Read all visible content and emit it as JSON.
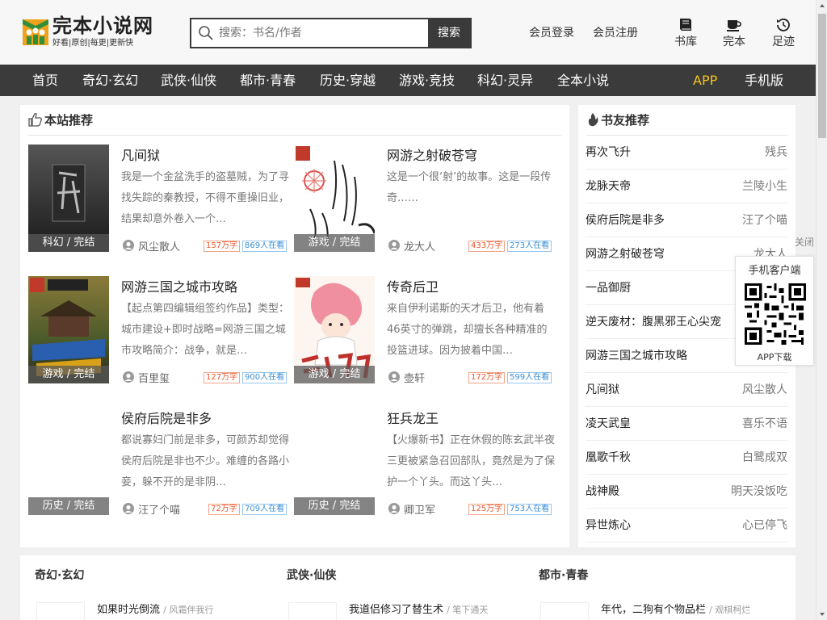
{
  "header": {
    "logo": {
      "title": "完本小说网",
      "subtitle": "好看|原创|每更|更新快"
    },
    "search": {
      "placeholder": "搜索：书名/作者",
      "button": "搜索"
    },
    "login": "会员登录",
    "register": "会员注册",
    "tools": [
      {
        "label": "书库",
        "icon": "book-icon"
      },
      {
        "label": "完本",
        "icon": "cup-icon"
      },
      {
        "label": "足迹",
        "icon": "history-icon"
      }
    ]
  },
  "nav": {
    "items": [
      "首页",
      "奇幻·玄幻",
      "武侠·仙侠",
      "都市·青春",
      "历史·穿越",
      "游戏·竞技",
      "科幻·灵异",
      "全本小说"
    ],
    "app": "APP",
    "mobile": "手机版"
  },
  "recommend": {
    "heading": "本站推荐",
    "books": [
      {
        "title": "凡间狱",
        "desc": "我是一个金盆洗手的盗墓贼，为了寻找失踪的秦教授，不得不重操旧业，结果却意外卷入一个…",
        "tag": "科幻 / 完结",
        "author": "风尘散人",
        "words": "157万字",
        "readers": "869人在看"
      },
      {
        "title": "网游之射破苍穹",
        "desc": "这是一个很‘射’的故事。这是一段传奇……",
        "tag": "游戏 / 完结",
        "author": "龙大人",
        "words": "433万字",
        "readers": "273人在看"
      },
      {
        "title": "网游三国之城市攻略",
        "desc": "【起点第四编辑组签约作品】类型：城市建设+即时战略=网游三国之城市攻略简介：战争，就是…",
        "tag": "游戏 / 完结",
        "author": "百里玺",
        "words": "127万字",
        "readers": "900人在看"
      },
      {
        "title": "传奇后卫",
        "desc": "来自伊利诺斯的天才后卫，他有着46英寸的弹跳，却擅长各种精准的投篮进球。因为披着中国…",
        "tag": "游戏 / 完结",
        "author": "壶轩",
        "words": "172万字",
        "readers": "599人在看"
      },
      {
        "title": "侯府后院是非多",
        "desc": "都说寡妇门前是非多，可颜苏却觉得侯府后院是非也不少。难缠的各路小妾，躲不开的是非阴…",
        "tag": "历史 / 完结",
        "author": "汪了个喵",
        "words": "72万字",
        "readers": "709人在看"
      },
      {
        "title": "狂兵龙王",
        "desc": "【火爆新书】正在休假的陈玄武半夜三更被紧急召回部队，竟然是为了保护一个丫头。而这丫头…",
        "tag": "历史 / 完结",
        "author": "卿卫军",
        "words": "125万字",
        "readers": "753人在看"
      }
    ]
  },
  "friends": {
    "heading": "书友推荐",
    "items": [
      {
        "title": "再次飞升",
        "author": "残兵"
      },
      {
        "title": "龙脉天帝",
        "author": "兰陵小生"
      },
      {
        "title": "侯府后院是非多",
        "author": "汪了个喵"
      },
      {
        "title": "网游之射破苍穹",
        "author": "龙大人"
      },
      {
        "title": "一品御厨",
        "author": ""
      },
      {
        "title": "逆天废材：腹黑邪王心尖宠",
        "author": ""
      },
      {
        "title": "网游三国之城市攻略",
        "author": ""
      },
      {
        "title": "凡间狱",
        "author": "风尘散人"
      },
      {
        "title": "凌天武皇",
        "author": "喜乐不语"
      },
      {
        "title": "凰歌千秋",
        "author": "白鹭成双"
      },
      {
        "title": "战神殿",
        "author": "明天没饭吃"
      },
      {
        "title": "异世炼心",
        "author": "心已停飞"
      }
    ]
  },
  "app_float": {
    "close": "关闭",
    "title": "手机客户端",
    "download": "APP下载"
  },
  "categories": [
    {
      "title": "奇幻·玄幻",
      "book": "如果时光倒流",
      "author": "/ 风霜伴我行"
    },
    {
      "title": "武侠·仙侠",
      "book": "我道侣修习了替生术",
      "author": "/ 笔下通天"
    },
    {
      "title": "都市·青春",
      "book": "年代，二狗有个物品栏",
      "author": "/ 观棋柯烂"
    }
  ],
  "colors": {
    "nav_bg": "#3b3b3b",
    "accent": "#f5c518",
    "words_badge": "#e8572a",
    "readers_badge": "#3b8fd6"
  }
}
